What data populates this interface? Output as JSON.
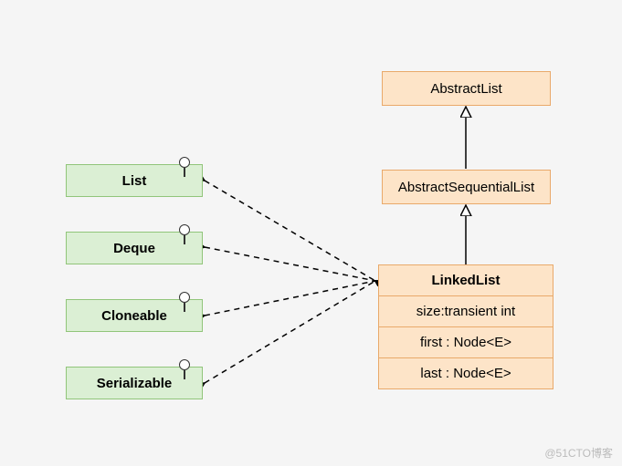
{
  "interfaces": {
    "list": "List",
    "deque": "Deque",
    "cloneable": "Cloneable",
    "serializable": "Serializable"
  },
  "classes": {
    "abstractList": "AbstractList",
    "abstractSequentialList": "AbstractSequentialList"
  },
  "linkedList": {
    "name": "LinkedList",
    "attrs": {
      "size": "size:transient int",
      "first": "first : Node<E>",
      "last": "last : Node<E>"
    }
  },
  "watermark": "@51CTO博客"
}
